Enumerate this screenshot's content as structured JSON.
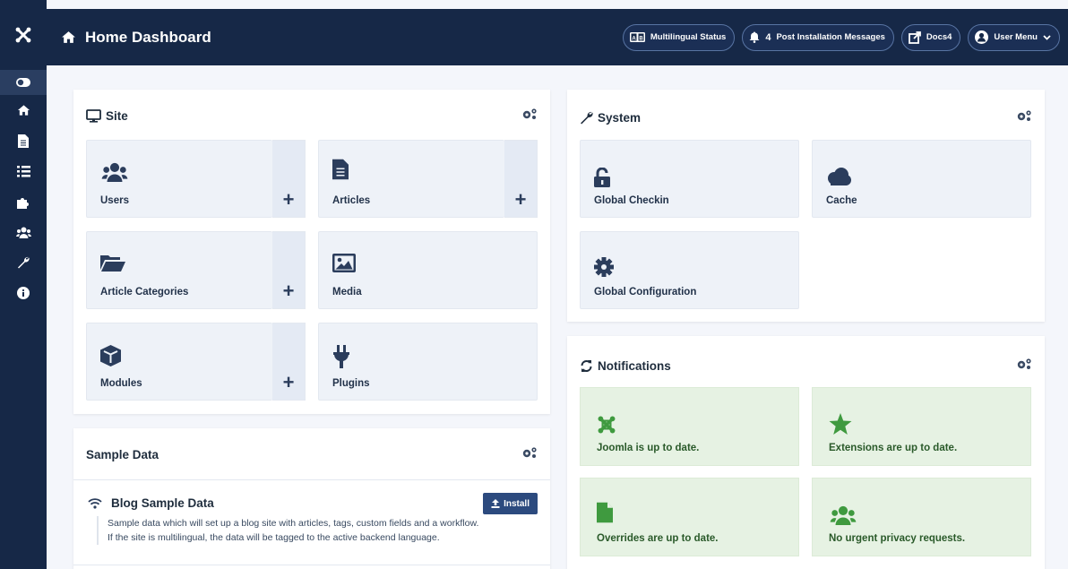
{
  "colors": {
    "sidebar": "#162847",
    "accent": "#2c4a7e",
    "tile": "#eef2f8",
    "notification_tile": "#e6f2e3",
    "notification_icon": "#3f9a3f"
  },
  "header": {
    "title": "Home Dashboard",
    "title_icon": "home-icon",
    "actions": [
      {
        "label": "Multilingual Status",
        "icon": "language-icon"
      },
      {
        "label": "Post Installation Messages",
        "icon": "bell-icon",
        "count": "4"
      },
      {
        "label": "Docs4",
        "icon": "external-link-icon"
      },
      {
        "label": "User Menu",
        "icon": "user-icon"
      }
    ]
  },
  "sidebar": {
    "items": [
      {
        "icon": "toggle-icon"
      },
      {
        "icon": "home-icon"
      },
      {
        "icon": "file-icon"
      },
      {
        "icon": "list-icon"
      },
      {
        "icon": "puzzle-icon"
      },
      {
        "icon": "users-icon"
      },
      {
        "icon": "wrench-icon"
      },
      {
        "icon": "info-icon"
      }
    ]
  },
  "site": {
    "title": "Site",
    "tiles": [
      {
        "label": "Users",
        "icon": "users-icon",
        "plus": "+"
      },
      {
        "label": "Articles",
        "icon": "file-icon",
        "plus": "+"
      },
      {
        "label": "Article Categories",
        "icon": "folder-open-icon",
        "plus": "+"
      },
      {
        "label": "Media",
        "icon": "image-icon"
      },
      {
        "label": "Modules",
        "icon": "cube-icon",
        "plus": "+"
      },
      {
        "label": "Plugins",
        "icon": "plug-icon"
      }
    ]
  },
  "system": {
    "title": "System",
    "tiles": [
      {
        "label": "Global Checkin",
        "icon": "unlock-icon"
      },
      {
        "label": "Cache",
        "icon": "cloud-icon"
      },
      {
        "label": "Global Configuration",
        "icon": "cog-icon"
      }
    ]
  },
  "notifications": {
    "title": "Notifications",
    "tiles": [
      {
        "label": "Joomla is up to date.",
        "icon": "joomla-icon"
      },
      {
        "label": "Extensions are up to date.",
        "icon": "star-icon"
      },
      {
        "label": "Overrides are up to date.",
        "icon": "file-icon"
      },
      {
        "label": "No urgent privacy requests.",
        "icon": "users-icon"
      }
    ]
  },
  "sample_data": {
    "title": "Sample Data",
    "blog": {
      "title": "Blog Sample Data",
      "install_label": "Install",
      "description_line1": "Sample data which will set up a blog site with articles, tags, custom fields and a workflow.",
      "description_line2": "If the site is multilingual, the data will be tagged to the active backend language."
    }
  }
}
